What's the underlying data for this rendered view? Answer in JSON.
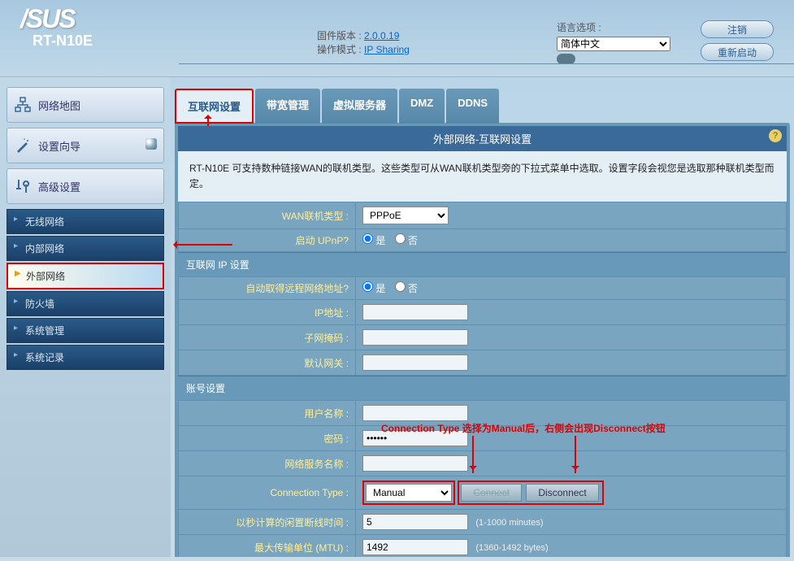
{
  "header": {
    "brand": "/SUS",
    "model": "RT-N10E",
    "fw_label": "固件版本 :",
    "fw_version": "2.0.0.19",
    "mode_label": "操作模式 :",
    "mode_value": "IP Sharing",
    "lang_label": "语言选项 :",
    "lang_value": "简体中文",
    "logout": "注销",
    "reboot": "重新启动"
  },
  "sidebar": {
    "map": "网络地图",
    "wizard": "设置向导",
    "advanced": "高级设置",
    "items": [
      {
        "label": "无线网络"
      },
      {
        "label": "内部网络"
      },
      {
        "label": "外部网络"
      },
      {
        "label": "防火墙"
      },
      {
        "label": "系统管理"
      },
      {
        "label": "系统记录"
      }
    ]
  },
  "tabs": [
    {
      "label": "互联网设置"
    },
    {
      "label": "带宽管理"
    },
    {
      "label": "虚拟服务器"
    },
    {
      "label": "DMZ"
    },
    {
      "label": "DDNS"
    }
  ],
  "panel": {
    "title": "外部网络-互联网设置",
    "desc": "RT-N10E 可支持数种链接WAN的联机类型。这些类型可从WAN联机类型旁的下拉式菜单中选取。设置字段会视您是选取那种联机类型而定。",
    "wan_type_label": "WAN联机类型 :",
    "wan_type_value": "PPPoE",
    "upnp_label": "启动 UPnP?",
    "yes": "是",
    "no": "否",
    "section_ip": "互联网 IP 设置",
    "auto_ip_label": "自动取得远程网络地址?",
    "ip_label": "IP地址 :",
    "mask_label": "子网掩码 :",
    "gw_label": "默认网关 :",
    "section_acct": "账号设置",
    "user_label": "用户名称 :",
    "user_value": "",
    "pwd_label": "密码 :",
    "pwd_value": "••••••",
    "svc_label": "网络服务名称 :",
    "conn_type_label": "Connection Type :",
    "conn_type_value": "Manual",
    "connect_btn": "Connect",
    "disconnect_btn": "Disconnect",
    "idle_label": "以秒计算的闲置断线时间 :",
    "idle_value": "5",
    "idle_hint": "(1-1000 minutes)",
    "mtu_label": "最大传输单位 (MTU)  :",
    "mtu_value": "1492",
    "mtu_hint": "(1360-1492 bytes)"
  },
  "annotation": {
    "text": "Connection Type 选择为Manual后，右侧会出现Disconnect按钮"
  }
}
